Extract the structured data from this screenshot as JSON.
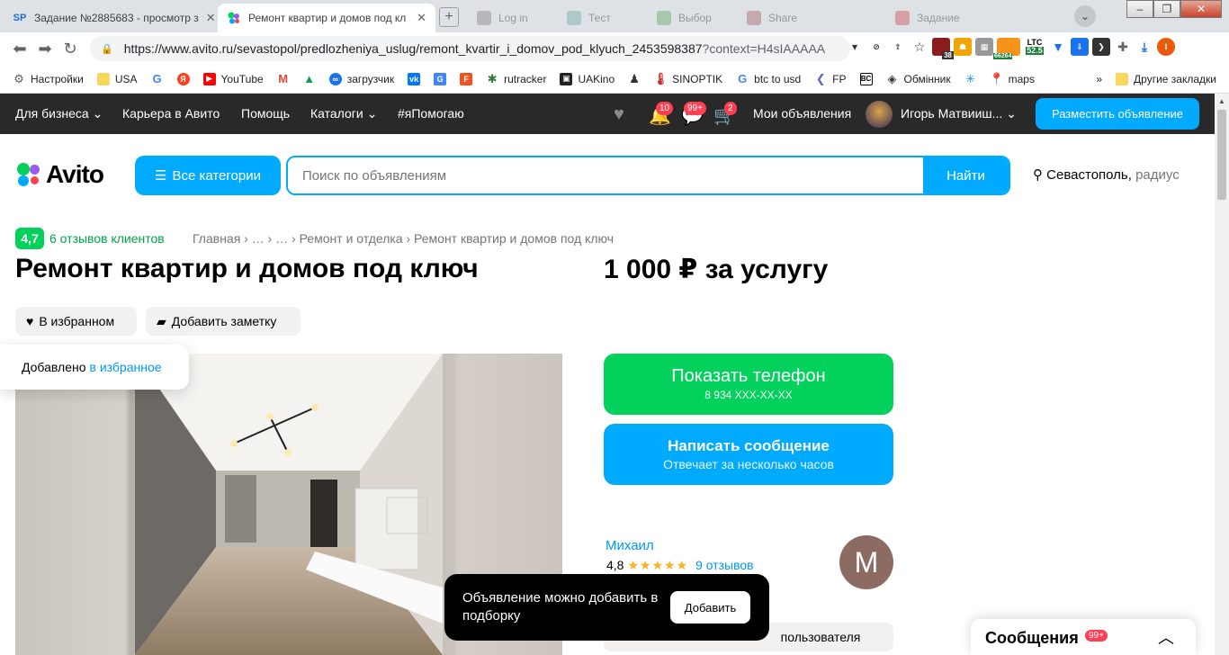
{
  "browser": {
    "tabs": [
      {
        "title": "Задание №2885683 - просмотр з",
        "favicon": "SP"
      },
      {
        "title": "Ремонт квартир и домов под кл",
        "favicon": ""
      },
      {
        "title": "Log in",
        "favicon": ""
      },
      {
        "title": "Тест",
        "favicon": ""
      },
      {
        "title": "Выбор",
        "favicon": ""
      },
      {
        "title": "Share",
        "favicon": ""
      },
      {
        "title": "Задание",
        "favicon": ""
      }
    ],
    "url_main": "https://www.avito.ru/sevastopol/predlozheniya_uslug/remont_kvartir_i_domov_pod_klyuch_2453598387",
    "url_rest": "?context=H4sIAAAAA...",
    "extensions": {
      "badge_38": "38",
      "btc": "66264",
      "ltc_label": "LTC",
      "ltc_value": "52.5"
    },
    "profile_letter": "I",
    "bookmarks": [
      "Настройки",
      "USA",
      "YouTube",
      "загрузчик",
      "rutracker",
      "UAKino",
      "SINOPTIK",
      "btc to usd",
      "FP",
      "Обмінник",
      "maps"
    ],
    "bookmarks_more": "»",
    "other_bookmarks": "Другие закладки"
  },
  "avito_nav": {
    "items": [
      "Для бизнеса",
      "Карьера в Авито",
      "Помощь",
      "Каталоги",
      "#яПомогаю"
    ],
    "notif_badge": "10",
    "msg_badge": "99+",
    "cart_badge": "2",
    "my_ads": "Мои объявления",
    "user_name": "Игорь Матвииш...",
    "post_button": "Разместить объявление"
  },
  "search": {
    "logo": "Avito",
    "all_categories": "Все категории",
    "placeholder": "Поиск по объявлениям",
    "find_button": "Найти",
    "city": "Севастополь,",
    "radius": "радиус"
  },
  "listing": {
    "rating": "4,7",
    "reviews_link": "6 отзывов клиентов",
    "breadcrumb": "Главная › … › … › Ремонт и отделка › Ремонт квартир и домов под ключ",
    "title": "Ремонт квартир и домов под ключ",
    "price": "1 000 ₽ за услугу",
    "favorite_chip": "В избранном",
    "note_chip": "Добавить заметку",
    "tooltip_text": "Добавлено",
    "tooltip_link": "в избранное"
  },
  "contact": {
    "show_phone": "Показать телефон",
    "phone_masked": "8 934 XXX-XX-XX",
    "write_message": "Написать сообщение",
    "response_time": "Отвечает за несколько часов"
  },
  "seller": {
    "name": "Михаил",
    "rating": "4,8",
    "stars": "★★★★★",
    "reviews": "9 отзывов",
    "avatar_letter": "M",
    "button_partial": "пользователя"
  },
  "toast": {
    "text": "Объявление можно добавить в подборку",
    "button": "Добавить"
  },
  "messages_panel": {
    "title": "Сообщения",
    "badge": "99+"
  },
  "colors": {
    "avito_blue": "#00aaff",
    "avito_green": "#02d15c",
    "nav_dark": "#292929",
    "badge_red": "#ff4053"
  }
}
